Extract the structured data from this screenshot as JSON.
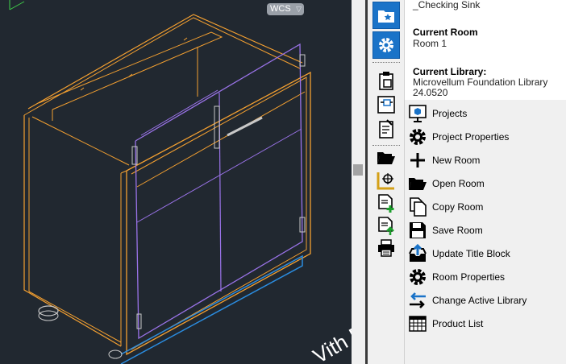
{
  "viewport": {
    "wcs_label": "WCS",
    "wcs_arrow": "▽",
    "watermark": "Vith F"
  },
  "toolbar": {
    "buttons": [
      {
        "name": "folder-star-icon",
        "active": true
      },
      {
        "name": "gear-icon",
        "active": true
      },
      {
        "name": "clipboard-icon",
        "active": false
      },
      {
        "name": "layout-icon",
        "active": false
      },
      {
        "name": "checklist-icon",
        "active": false
      },
      {
        "name": "open-folder-icon",
        "active": false
      },
      {
        "name": "measure-icon",
        "active": false
      },
      {
        "name": "add-document-icon",
        "active": false
      },
      {
        "name": "upload-document-icon",
        "active": false
      },
      {
        "name": "printer-icon",
        "active": false
      }
    ]
  },
  "info": {
    "top_text": "_Checking Sink",
    "current_room_label": "Current Room",
    "current_room_value": "Room 1",
    "current_library_label": "Current Library:",
    "current_library_value_1": "Microvellum Foundation Library",
    "current_library_value_2": "24.0520"
  },
  "menu": {
    "items": [
      {
        "label": "Projects",
        "icon": "projects-icon"
      },
      {
        "label": "Project Properties",
        "icon": "gear-icon"
      },
      {
        "label": "New Room",
        "icon": "plus-icon"
      },
      {
        "label": "Open Room",
        "icon": "open-folder-icon"
      },
      {
        "label": "Copy Room",
        "icon": "copy-icon"
      },
      {
        "label": "Save Room",
        "icon": "save-icon"
      },
      {
        "label": "Update Title Block",
        "icon": "upload-tray-icon"
      },
      {
        "label": "Room Properties",
        "icon": "gear-icon"
      },
      {
        "label": "Change Active Library",
        "icon": "swap-arrows-icon"
      },
      {
        "label": "Product List",
        "icon": "grid-icon"
      }
    ]
  },
  "colors": {
    "viewport_bg": "#212830",
    "cabinet_orange": "#f4a030",
    "door_purple": "#9a73e8",
    "base_blue": "#2b8de0",
    "active_button": "#1a73c8"
  }
}
